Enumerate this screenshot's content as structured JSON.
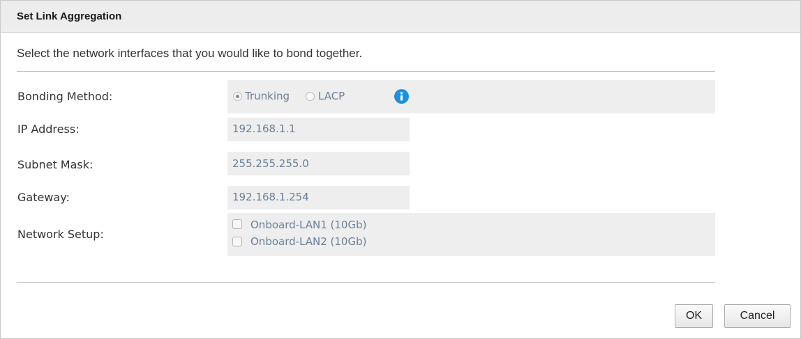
{
  "dialog": {
    "title": "Set Link Aggregation",
    "intro": "Select the network interfaces that you would like to bond together."
  },
  "form": {
    "bonding_method": {
      "label": "Bonding Method:",
      "options": [
        {
          "label": "Trunking",
          "selected": true
        },
        {
          "label": "LACP",
          "selected": false
        }
      ],
      "info_icon": "info-icon"
    },
    "ip_address": {
      "label": "IP Address:",
      "value": "192.168.1.1"
    },
    "subnet_mask": {
      "label": "Subnet Mask:",
      "value": "255.255.255.0"
    },
    "gateway": {
      "label": "Gateway:",
      "value": "192.168.1.254"
    },
    "network_setup": {
      "label": "Network Setup:",
      "interfaces": [
        {
          "label": "Onboard-LAN1 (10Gb)",
          "checked": false
        },
        {
          "label": "Onboard-LAN2 (10Gb)",
          "checked": false
        }
      ]
    }
  },
  "buttons": {
    "ok": "OK",
    "cancel": "Cancel"
  },
  "colors": {
    "titlebar": "#ededed",
    "field_background": "#eeeeee",
    "field_text": "#6b7f96",
    "info_icon": "#1f8fe0"
  }
}
